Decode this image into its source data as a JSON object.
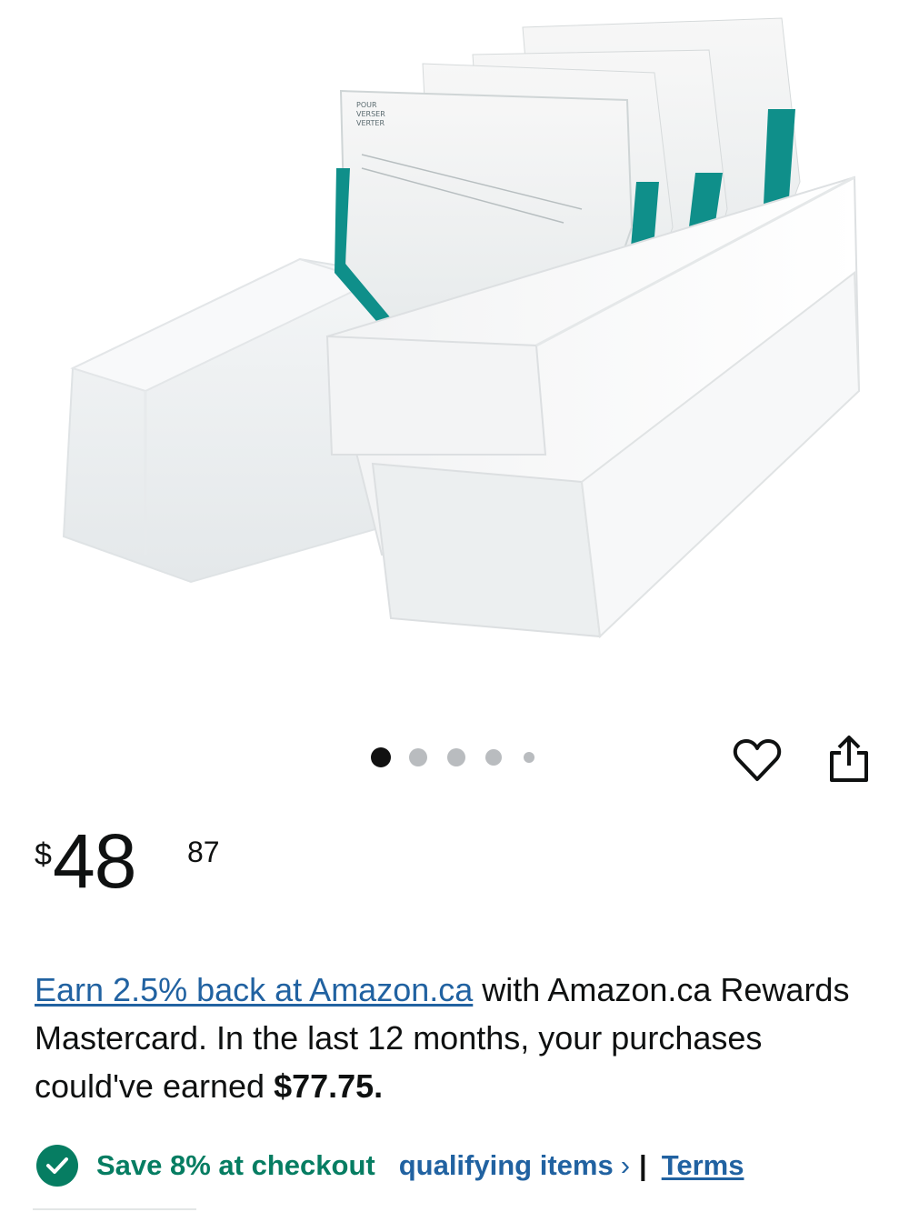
{
  "gallery": {
    "image_alt": "Breast milk storage bag organizer with bags and lid",
    "dot_count": 5,
    "active_dot": 0
  },
  "icons": {
    "wishlist": "heart-icon",
    "share": "share-icon",
    "check": "check-circle-icon"
  },
  "price": {
    "symbol": "$",
    "whole": "48",
    "fraction": "87"
  },
  "rewards": {
    "link_text": "Earn 2.5% back at Amazon.ca",
    "text_1": " with Amazon.ca Rewards Mastercard. In the last 12 months, your purchases could've earned ",
    "amount": "$77.75."
  },
  "savings": {
    "save_text": "Save 8% at checkout",
    "qualifying_text": "qualifying items",
    "chevron": "›",
    "separator": "|",
    "terms_text": "Terms"
  },
  "colors": {
    "link": "#2162a1",
    "success_green": "#067d62",
    "dot_active": "#111111",
    "dot_inactive": "#b9bcbf",
    "teal_bag": "#0f8f8a"
  }
}
